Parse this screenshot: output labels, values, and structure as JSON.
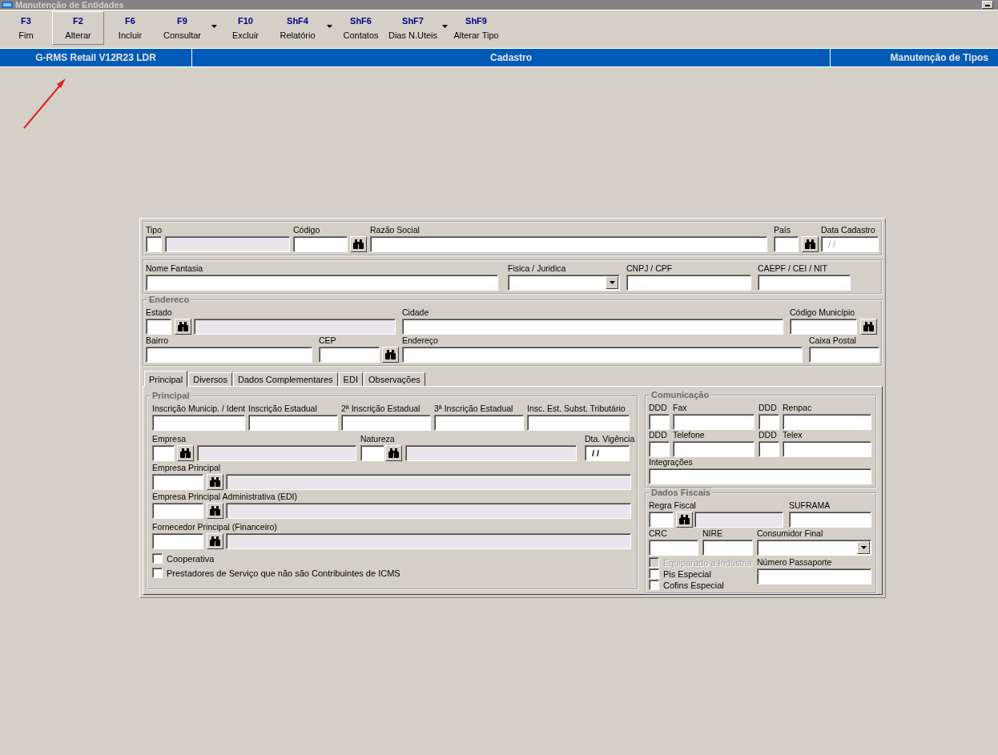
{
  "window": {
    "title": "Manutenção de Entidades"
  },
  "toolbar": [
    {
      "key": "F3",
      "label": "Fim",
      "selected": false,
      "dropdown": false
    },
    {
      "key": "F2",
      "label": "Alterar",
      "selected": true,
      "dropdown": false
    },
    {
      "key": "F6",
      "label": "Incluir",
      "selected": false,
      "dropdown": false
    },
    {
      "key": "F9",
      "label": "Consultar",
      "selected": false,
      "dropdown": true
    },
    {
      "key": "F10",
      "label": "Excluir",
      "selected": false,
      "dropdown": false
    },
    {
      "key": "ShF4",
      "label": "Relatório",
      "selected": false,
      "dropdown": true
    },
    {
      "key": "ShF6",
      "label": "Contatos",
      "selected": false,
      "dropdown": false
    },
    {
      "key": "ShF7",
      "label": "Dias N.Uteis",
      "selected": false,
      "dropdown": true
    },
    {
      "key": "ShF9",
      "label": "Alterar Tipo",
      "selected": false,
      "dropdown": false
    }
  ],
  "banner": [
    "G-RMS Retail V12R23 LDR",
    "Cadastro",
    "Manutenção de Tipos"
  ],
  "panels": [
    {
      "lines": [
        {
          "fields": [
            {
              "label": "Tipo",
              "controls": [
                {
                  "kind": "input"
                },
                {
                  "kind": "readonly"
                }
              ]
            },
            {
              "label": "Código",
              "controls": [
                {
                  "kind": "input"
                },
                {
                  "kind": "lookup"
                }
              ]
            },
            {
              "label": "Razão Social",
              "controls": [
                {
                  "kind": "input"
                }
              ]
            },
            {
              "label": "País",
              "controls": [
                {
                  "kind": "input"
                },
                {
                  "kind": "lookup"
                }
              ]
            },
            {
              "label": "Data Cadastro",
              "controls": [
                {
                  "kind": "date",
                  "value": "/ /",
                  "disabled": true
                }
              ]
            }
          ]
        }
      ]
    },
    {
      "lines": [
        {
          "fields": [
            {
              "label": "Nome Fantasia",
              "controls": [
                {
                  "kind": "input"
                }
              ]
            },
            {
              "label": "Fisica / Juridica",
              "controls": [
                {
                  "kind": "combo"
                }
              ]
            },
            {
              "label": "CNPJ / CPF",
              "controls": [
                {
                  "kind": "input"
                }
              ]
            },
            {
              "label": "CAEPF / CEI / NIT",
              "controls": [
                {
                  "kind": "input"
                }
              ]
            }
          ]
        }
      ]
    },
    {
      "legend": "Endereco",
      "lines": [
        {
          "fields": [
            {
              "label": "Estado",
              "controls": [
                {
                  "kind": "input"
                },
                {
                  "kind": "lookup"
                },
                {
                  "kind": "readonly"
                }
              ]
            },
            {
              "label": "Cidade",
              "controls": [
                {
                  "kind": "input"
                }
              ]
            },
            {
              "label": "Código Município",
              "controls": [
                {
                  "kind": "input"
                },
                {
                  "kind": "lookup"
                }
              ]
            }
          ]
        },
        {
          "fields": [
            {
              "label": "Bairro",
              "controls": [
                {
                  "kind": "input"
                }
              ]
            },
            {
              "label": "CEP",
              "controls": [
                {
                  "kind": "input"
                },
                {
                  "kind": "lookup"
                }
              ]
            },
            {
              "label": "Endereço",
              "controls": [
                {
                  "kind": "input"
                }
              ]
            },
            {
              "label": "Caixa Postal",
              "controls": [
                {
                  "kind": "input"
                }
              ]
            }
          ]
        }
      ]
    }
  ],
  "tabs": [
    {
      "label": "Principal",
      "selected": true
    },
    {
      "label": "Diversos",
      "selected": false
    },
    {
      "label": "Dados Complementares",
      "selected": false
    },
    {
      "label": "EDI",
      "selected": false
    },
    {
      "label": "Observações",
      "selected": false
    }
  ],
  "tab_panel": {
    "left": {
      "legend": "Principal",
      "lines": [
        {
          "fields": [
            {
              "label": "Inscrição Municip. / Ident",
              "controls": [
                {
                  "kind": "input"
                }
              ]
            },
            {
              "label": "Inscrição Estadual",
              "controls": [
                {
                  "kind": "input"
                }
              ]
            },
            {
              "label": "2ª Inscrição Estadual",
              "controls": [
                {
                  "kind": "input"
                }
              ]
            },
            {
              "label": "3ª Inscrição Estadual",
              "controls": [
                {
                  "kind": "input"
                }
              ]
            },
            {
              "label": "Insc. Est. Subst. Tributário",
              "controls": [
                {
                  "kind": "input"
                }
              ]
            }
          ]
        },
        {
          "fields": [
            {
              "label": "Empresa",
              "controls": [
                {
                  "kind": "input"
                },
                {
                  "kind": "lookup"
                },
                {
                  "kind": "readonly"
                }
              ]
            },
            {
              "label": "Natureza",
              "controls": [
                {
                  "kind": "input"
                },
                {
                  "kind": "lookup"
                },
                {
                  "kind": "readonly"
                }
              ]
            },
            {
              "label": "Dta. Vigência",
              "controls": [
                {
                  "kind": "date",
                  "value": "/ /",
                  "disabled": false
                }
              ]
            }
          ]
        },
        {
          "fields": [
            {
              "label": "Empresa Principal",
              "controls": [
                {
                  "kind": "input"
                },
                {
                  "kind": "lookup"
                },
                {
                  "kind": "readonly"
                }
              ]
            }
          ]
        },
        {
          "fields": [
            {
              "label": "Empresa Principal Administrativa (EDI)",
              "controls": [
                {
                  "kind": "input"
                },
                {
                  "kind": "lookup"
                },
                {
                  "kind": "readonly"
                }
              ]
            }
          ]
        },
        {
          "fields": [
            {
              "label": "Fornecedor Principal (Financeiro)",
              "controls": [
                {
                  "kind": "input"
                },
                {
                  "kind": "lookup"
                },
                {
                  "kind": "readonly"
                }
              ]
            }
          ]
        },
        {
          "fields": [
            {
              "checks": [
                {
                  "label": "Cooperativa",
                  "checked": false,
                  "disabled": false
                }
              ]
            }
          ]
        },
        {
          "fields": [
            {
              "checks": [
                {
                  "label": "Prestadores de Serviço que não são Contribuintes de ICMS",
                  "checked": false,
                  "disabled": false
                }
              ]
            }
          ]
        }
      ]
    },
    "right": [
      {
        "legend": "Comunicação",
        "lines": [
          {
            "fields": [
              {
                "label": "DDD",
                "controls": [
                  {
                    "kind": "input"
                  }
                ]
              },
              {
                "label": "Fax",
                "controls": [
                  {
                    "kind": "input"
                  }
                ]
              },
              {
                "label": "DDD",
                "controls": [
                  {
                    "kind": "input"
                  }
                ]
              },
              {
                "label": "Renpac",
                "controls": [
                  {
                    "kind": "input"
                  }
                ]
              }
            ]
          },
          {
            "fields": [
              {
                "label": "DDD",
                "controls": [
                  {
                    "kind": "input"
                  }
                ]
              },
              {
                "label": "Telefone",
                "controls": [
                  {
                    "kind": "input"
                  }
                ]
              },
              {
                "label": "DDD",
                "controls": [
                  {
                    "kind": "input"
                  }
                ]
              },
              {
                "label": "Telex",
                "controls": [
                  {
                    "kind": "input"
                  }
                ]
              }
            ]
          },
          {
            "fields": [
              {
                "label": "Integrações",
                "controls": [
                  {
                    "kind": "input"
                  }
                ]
              }
            ]
          }
        ]
      },
      {
        "legend": "Dados Fiscais",
        "lines": [
          {
            "fields": [
              {
                "label": "Regra Fiscal",
                "controls": [
                  {
                    "kind": "input"
                  },
                  {
                    "kind": "lookup"
                  },
                  {
                    "kind": "readonly"
                  }
                ]
              },
              {
                "label": "SUFRAMA",
                "controls": [
                  {
                    "kind": "input"
                  }
                ]
              }
            ]
          },
          {
            "fields": [
              {
                "label": "CRC",
                "controls": [
                  {
                    "kind": "input"
                  }
                ]
              },
              {
                "label": "NIRE",
                "controls": [
                  {
                    "kind": "input"
                  }
                ]
              },
              {
                "label": "Consumidor Final",
                "controls": [
                  {
                    "kind": "combo"
                  }
                ]
              }
            ]
          },
          {
            "fields": [
              {
                "checks": [
                  {
                    "label": "Equiparado a Indústria",
                    "checked": false,
                    "disabled": true
                  },
                  {
                    "label": "Pis Especial",
                    "checked": false,
                    "disabled": false
                  },
                  {
                    "label": "Cofins Especial",
                    "checked": false,
                    "disabled": false
                  }
                ]
              },
              {
                "label": "Número Passaporte",
                "controls": [
                  {
                    "kind": "input"
                  }
                ]
              }
            ]
          }
        ]
      }
    ]
  }
}
